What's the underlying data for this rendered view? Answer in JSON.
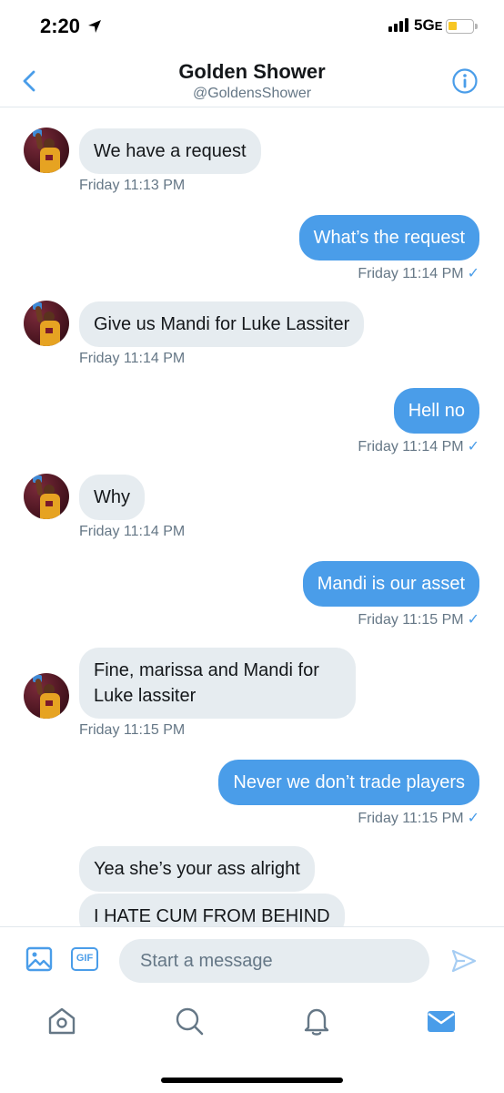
{
  "status_bar": {
    "time": "2:20",
    "network": "5G",
    "network_suffix": "E"
  },
  "header": {
    "title": "Golden Shower",
    "handle": "@GoldensShower"
  },
  "messages": [
    {
      "direction": "in",
      "text": "We have a request",
      "timestamp": "Friday 11:13 PM"
    },
    {
      "direction": "out",
      "text": "What’s the request",
      "timestamp": "Friday 11:14 PM"
    },
    {
      "direction": "in",
      "text": "Give us Mandi for Luke Lassiter",
      "timestamp": "Friday 11:14 PM"
    },
    {
      "direction": "out",
      "text": "Hell no",
      "timestamp": "Friday 11:14 PM"
    },
    {
      "direction": "in",
      "text": "Why",
      "timestamp": "Friday 11:14 PM"
    },
    {
      "direction": "out",
      "text": "Mandi is our asset",
      "timestamp": "Friday 11:15 PM"
    },
    {
      "direction": "in",
      "text": "Fine, marissa and Mandi for Luke lassiter",
      "timestamp": "Friday 11:15 PM"
    },
    {
      "direction": "out",
      "text": "Never we don’t trade players",
      "timestamp": "Friday 11:15 PM"
    },
    {
      "direction": "in",
      "text": "Yea she’s your ass alright",
      "timestamp": ""
    },
    {
      "direction": "in",
      "text": "I HATE CUM FROM BEHIND",
      "timestamp": ""
    }
  ],
  "read_check": "✓",
  "composer": {
    "placeholder": "Start a message",
    "gif_label": "GIF"
  },
  "tabbar": {
    "items": [
      "home-icon",
      "search-icon",
      "notifications-icon",
      "messages-icon"
    ],
    "active": "messages-icon"
  },
  "colors": {
    "accent": "#4a9de9",
    "incoming_bubble": "#e6ecf0",
    "secondary_text": "#657786",
    "battery": "#f7c623"
  }
}
